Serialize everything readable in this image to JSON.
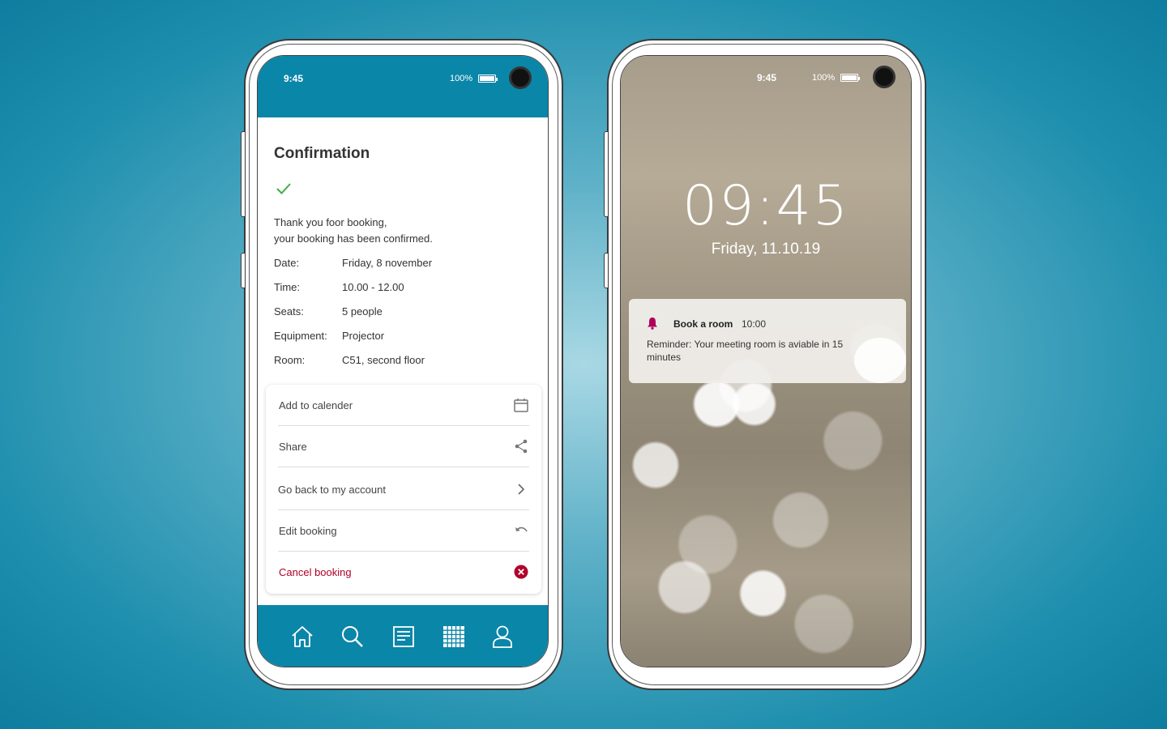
{
  "left_phone": {
    "status": {
      "time": "9:45",
      "battery": "100%"
    },
    "title": "Confirmation",
    "thanks_line1": "Thank you foor booking,",
    "thanks_line2": "your booking has been confirmed.",
    "details": [
      {
        "label": "Date:",
        "value": "Friday, 8 november"
      },
      {
        "label": "Time:",
        "value": "10.00 - 12.00"
      },
      {
        "label": "Seats:",
        "value": "5 people"
      },
      {
        "label": "Equipment:",
        "value": "Projector"
      },
      {
        "label": "Room:",
        "value": "C51, second floor"
      }
    ],
    "actions": [
      {
        "label": "Add to calender",
        "icon": "calendar-icon"
      },
      {
        "label": "Share",
        "icon": "share-icon"
      },
      {
        "label": "Go back to my account",
        "icon": "chevron-right-icon"
      },
      {
        "label": "Edit booking",
        "icon": "undo-icon"
      },
      {
        "label": "Cancel booking",
        "icon": "cancel-circle-icon"
      }
    ],
    "nav": [
      "home-icon",
      "search-icon",
      "document-icon",
      "grid-icon",
      "user-icon"
    ],
    "colors": {
      "accent": "#0a86a8",
      "success": "#3cb043",
      "danger": "#b0002a"
    }
  },
  "right_phone": {
    "status": {
      "time": "9:45",
      "battery": "100%"
    },
    "clock": "09:45",
    "date": "Friday, 11.10.19",
    "notification": {
      "app": "Book a room",
      "time": "10:00",
      "body": "Reminder: Your meeting room is aviable in 15 minutes",
      "icon": "bell-icon",
      "icon_color": "#b0005a"
    }
  }
}
